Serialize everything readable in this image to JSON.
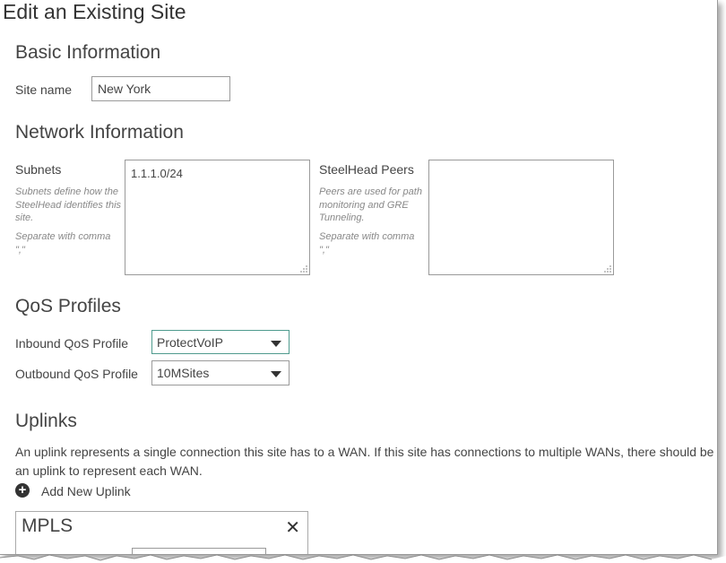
{
  "page": {
    "title": "Edit an Existing Site"
  },
  "basic": {
    "heading": "Basic Information",
    "site_name_label": "Site name",
    "site_name_value": "New York"
  },
  "network": {
    "heading": "Network Information",
    "subnets": {
      "label": "Subnets",
      "hint": "Subnets define how the SteelHead identifies this site.",
      "separator_hint": "Separate with comma \",\"",
      "value": "1.1.1.0/24"
    },
    "peers": {
      "label": "SteelHead Peers",
      "hint": "Peers are used for path monitoring and GRE Tunneling.",
      "separator_hint": "Separate with comma \",\"",
      "value": ""
    }
  },
  "qos": {
    "heading": "QoS Profiles",
    "inbound_label": "Inbound QoS Profile",
    "inbound_value": "ProtectVoIP",
    "outbound_label": "Outbound QoS Profile",
    "outbound_value": "10MSites"
  },
  "uplinks": {
    "heading": "Uplinks",
    "description": "An uplink represents a single connection this site has to a WAN. If this site has connections to multiple WANs, there should be an uplink to represent each WAN.",
    "add_label": "Add New Uplink",
    "add_icon": "plus-circle-icon",
    "cards": [
      {
        "title": "MPLS",
        "close_icon": "close-icon"
      }
    ]
  },
  "colors": {
    "text": "#444444",
    "hint": "#888888",
    "border": "#9a9a9a",
    "focus_border": "#4f9b8e"
  }
}
